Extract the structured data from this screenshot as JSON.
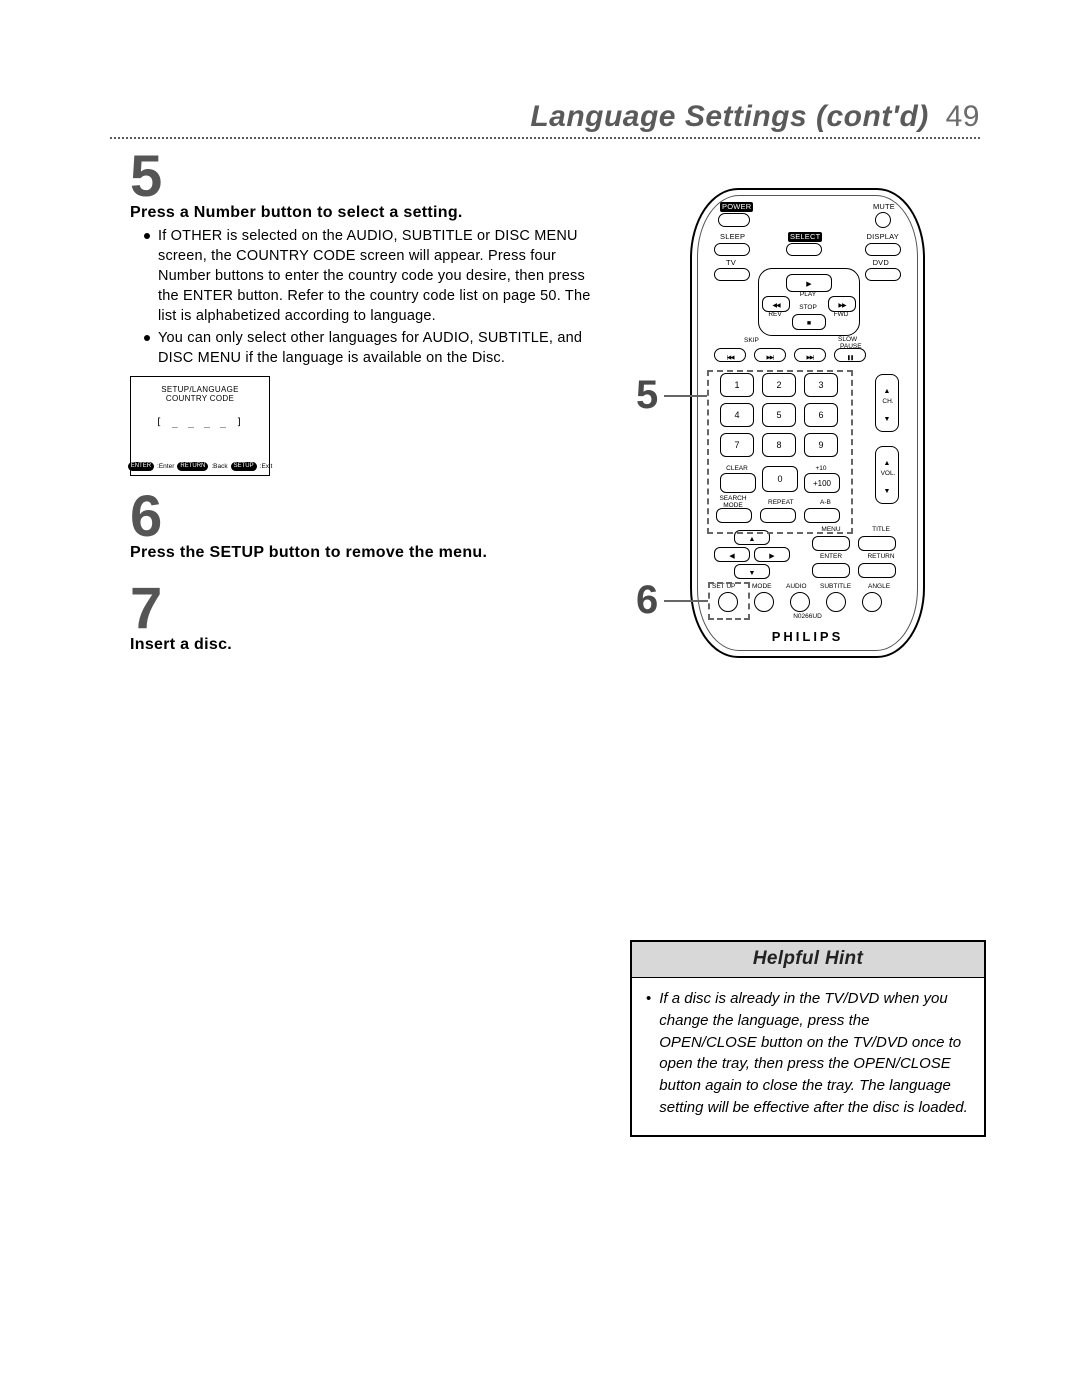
{
  "header": {
    "title": "Language Settings (cont'd)",
    "page_number": "49"
  },
  "steps": {
    "s5": {
      "num": "5",
      "heading": "Press a Number button to select a setting.",
      "bullets": [
        "If OTHER is selected on the AUDIO, SUBTITLE or DISC MENU screen, the COUNTRY CODE screen will appear. Press four Number buttons to enter the country code you desire, then press the ENTER button. Refer to the country code list on page 50. The list is alphabetized according to language.",
        "You can only select other languages for AUDIO, SUBTITLE, and DISC MENU if the language is available on the Disc."
      ]
    },
    "s6": {
      "num": "6",
      "heading": "Press the SETUP button to remove the menu."
    },
    "s7": {
      "num": "7",
      "heading": "Insert a disc."
    }
  },
  "osd": {
    "line1": "SETUP/LANGUAGE",
    "line2": "COUNTRY CODE",
    "code": "[ _ _ _ _ ]",
    "foot_enter": "ENTER",
    "foot_enter_after": ":Enter",
    "foot_return": "RETURN",
    "foot_return_after": ":Back",
    "foot_setup": "SETUP",
    "foot_setup_after": ":Exit"
  },
  "remote": {
    "brand": "PHILIPS",
    "model": "N0266UD",
    "labels": {
      "power": "POWER",
      "mute": "MUTE",
      "sleep": "SLEEP",
      "select": "SELECT",
      "display": "DISPLAY",
      "tv": "TV",
      "dvd": "DVD",
      "play": "PLAY",
      "rev": "REV",
      "fwd": "FWD",
      "stop": "STOP",
      "skip": "SKIP",
      "slow": "SLOW",
      "pause": "PAUSE",
      "ch": "CH.",
      "vol": "VOL.",
      "clear": "CLEAR",
      "plus10": "+10",
      "plus100": "+100",
      "searchmode": "SEARCH MODE",
      "repeat": "REPEAT",
      "ab": "A-B",
      "menu": "MENU",
      "title": "TITLE",
      "enter": "ENTER",
      "return": "RETURN",
      "setup": "SET UP",
      "mode": "MODE",
      "audio": "AUDIO",
      "subtitle": "SUBTITLE",
      "angle": "ANGLE"
    },
    "numpad": [
      "1",
      "2",
      "3",
      "4",
      "5",
      "6",
      "7",
      "8",
      "9",
      "0"
    ],
    "callouts": {
      "five": "5",
      "six": "6"
    }
  },
  "hint": {
    "title": "Helpful Hint",
    "body": "If a disc is already in the TV/DVD when you change the language, press the OPEN/CLOSE button on the TV/DVD once to open the tray, then press the OPEN/CLOSE button again to close the tray. The language setting will be effective after the disc is loaded."
  }
}
